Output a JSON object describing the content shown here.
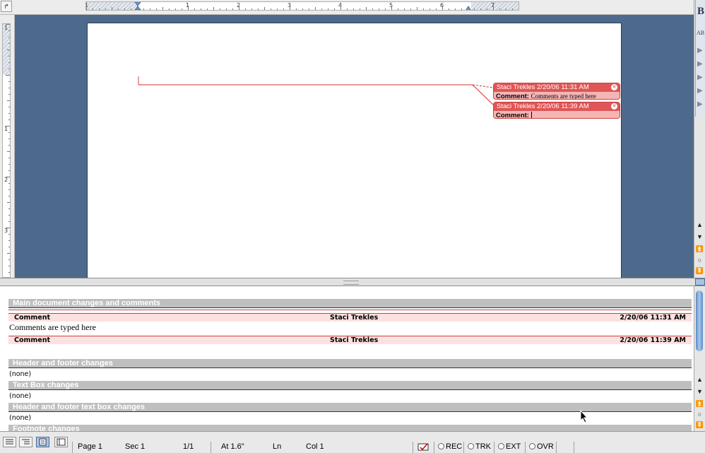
{
  "ruler": {
    "numbers": [
      "1",
      "1",
      "2",
      "3",
      "4",
      "5",
      "6",
      "7"
    ],
    "vertical_numbers": [
      "1",
      "1",
      "2",
      "3"
    ]
  },
  "balloons": [
    {
      "header": "Staci Trekles 2/20/06 11:31 AM",
      "label": "Comment:",
      "text": "Comments are typed here"
    },
    {
      "header": "Staci Trekles 2/20/06 11:39 AM",
      "label": "Comment:",
      "text": ""
    }
  ],
  "review": {
    "main_header": "Main document changes and comments",
    "comments": [
      {
        "type": "Comment",
        "author": "Staci Trekles",
        "date": "2/20/06 11:31 AM",
        "text": "Comments are typed here"
      },
      {
        "type": "Comment",
        "author": "Staci Trekles",
        "date": "2/20/06 11:39 AM",
        "text": ""
      }
    ],
    "sections": [
      {
        "header": "Header and footer changes",
        "value": "(none)"
      },
      {
        "header": "Text Box changes",
        "value": "(none)"
      },
      {
        "header": "Header and footer text box changes",
        "value": "(none)"
      },
      {
        "header": "Footnote changes",
        "value": ""
      }
    ]
  },
  "toolbox": {
    "letter": "B",
    "small": "AB"
  },
  "status": {
    "page": "Page  1",
    "sec": "Sec  1",
    "pages": "1/1",
    "at": "At  1.6\"",
    "ln": "Ln",
    "col": "Col  1",
    "rec": "REC",
    "trk": "TRK",
    "ext": "EXT",
    "ovr": "OVR"
  },
  "colors": {
    "doc_bg": "#4d6a8c",
    "comment_red": "#e05555",
    "comment_fill": "#f5b5b5",
    "section_gray": "#bfbfbf"
  }
}
